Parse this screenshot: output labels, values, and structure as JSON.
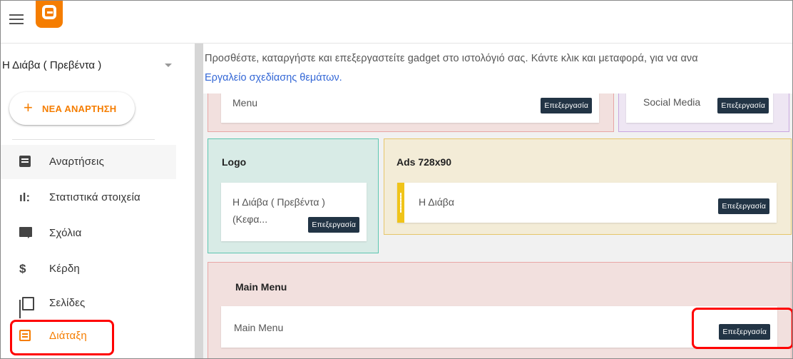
{
  "brand": {
    "accent": "#f57d00",
    "edit_button_color": "#223445",
    "link_color": "#3367d6",
    "callout_color": "#ff0000"
  },
  "topbar": {
    "menu_icon": "hamburger-menu-icon",
    "logo_icon": "blogger-logo-icon"
  },
  "sidebar": {
    "blog_name": "Η Διάβα ( Πρεβέντα )",
    "new_post_plus": "+",
    "new_post_label": "ΝΕΑ ΑΝΑΡΤΗΣΗ",
    "items": [
      {
        "label": "Αναρτήσεις",
        "icon": "posts-icon"
      },
      {
        "label": "Στατιστικά στοιχεία",
        "icon": "stats-icon",
        "glyph": "ıl:"
      },
      {
        "label": "Σχόλια",
        "icon": "comments-icon"
      },
      {
        "label": "Κέρδη",
        "icon": "earnings-icon",
        "glyph": "$"
      },
      {
        "label": "Σελίδες",
        "icon": "pages-icon"
      },
      {
        "label": "Διάταξη",
        "icon": "layout-icon",
        "selected": true
      }
    ]
  },
  "main": {
    "info_text": "Προσθέστε, καταργήστε και επεξεργαστείτε gadget στο ιστολόγιό σας. Κάντε κλικ και μεταφορά, για να ανα",
    "info_link": "Εργαλείο σχεδίασης θεμάτων.",
    "edit_label": "Επεξεργασία",
    "sections": {
      "menu_top": {
        "gadget": "Menu"
      },
      "social": {
        "gadget": "Social Media"
      },
      "logo": {
        "title": "Logo",
        "gadget_line1": "Η Διάβα ( Πρεβέντα )",
        "gadget_line2": "(Κεφα..."
      },
      "ads": {
        "title": "Ads 728x90",
        "gadget": "Η Διάβα"
      },
      "main_menu": {
        "title": "Main Menu",
        "gadget": "Main Menu"
      }
    }
  }
}
